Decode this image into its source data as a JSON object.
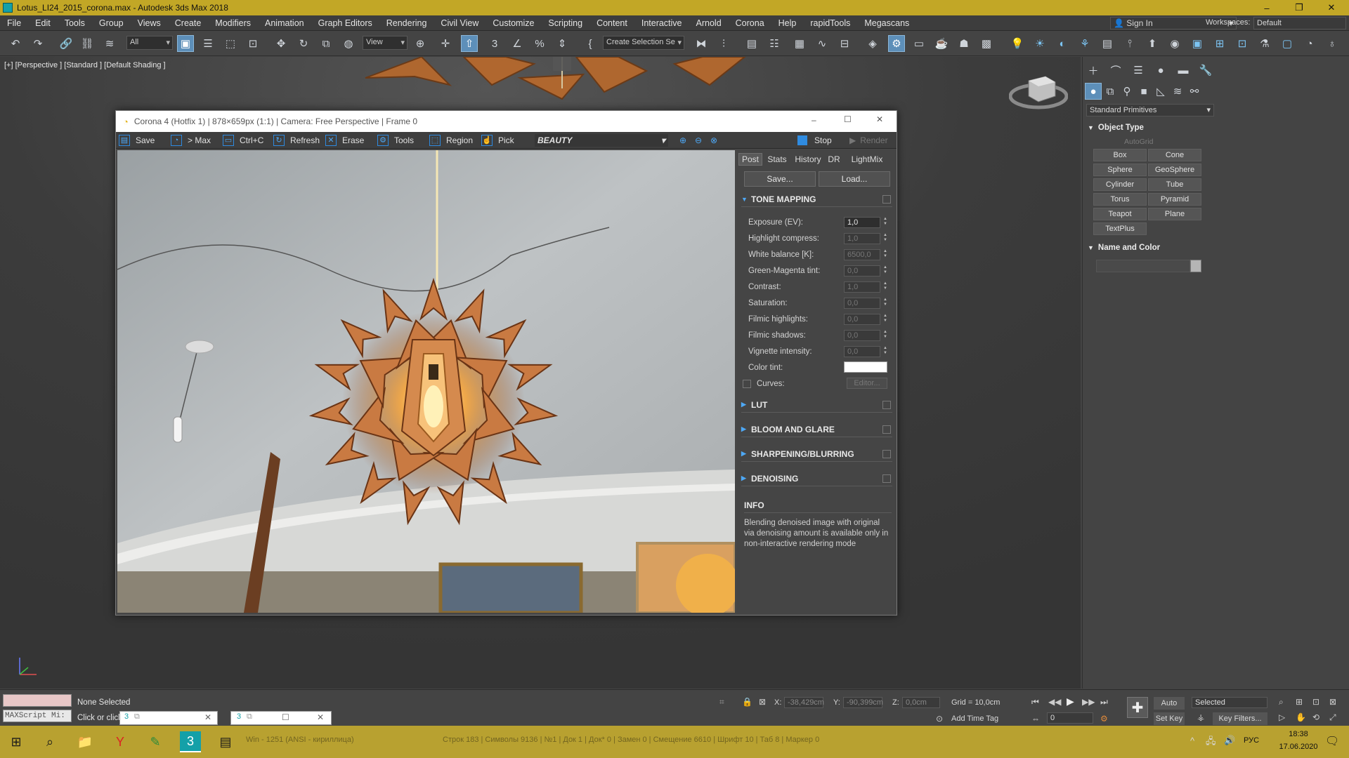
{
  "window": {
    "title": "Lotus_LI24_2015_corona.max - Autodesk 3ds Max 2018",
    "controls": {
      "minimize": "–",
      "restore": "❐",
      "close": "✕"
    }
  },
  "menu": [
    "File",
    "Edit",
    "Tools",
    "Group",
    "Views",
    "Create",
    "Modifiers",
    "Animation",
    "Graph Editors",
    "Rendering",
    "Civil View",
    "Customize",
    "Scripting",
    "Content",
    "Interactive",
    "Arnold",
    "Corona",
    "Help",
    "rapidTools",
    "Megascans"
  ],
  "account": {
    "sign_in": "Sign In",
    "workspaces_label": "Workspaces:",
    "workspace": "Default"
  },
  "toolbar": {
    "filter": "All",
    "view": "View",
    "selection_set": "Create Selection Se"
  },
  "viewport": {
    "label": "[+] [Perspective ] [Standard ] [Default Shading ]"
  },
  "command_panel": {
    "category": "Standard Primitives",
    "object_type_title": "Object Type",
    "autogrid": "AutoGrid",
    "buttons": [
      "Box",
      "Cone",
      "Sphere",
      "GeoSphere",
      "Cylinder",
      "Tube",
      "Torus",
      "Pyramid",
      "Teapot",
      "Plane",
      "TextPlus"
    ],
    "name_color_title": "Name and Color",
    "name_value": ""
  },
  "corona": {
    "title": "Corona 4 (Hotfix 1) | 878×659px (1:1) | Camera: Free Perspective | Frame 0",
    "toolbar": {
      "save": "Save",
      "max": "> Max",
      "copy": "Ctrl+C",
      "refresh": "Refresh",
      "erase": "Erase",
      "tools": "Tools",
      "region": "Region",
      "pick": "Pick",
      "channel": "BEAUTY",
      "stop": "Stop",
      "render": "Render"
    },
    "tabs": [
      "Post",
      "Stats",
      "History",
      "DR",
      "LightMix"
    ],
    "save_btn": "Save...",
    "load_btn": "Load...",
    "tone_mapping": "TONE MAPPING",
    "params": [
      {
        "label": "Exposure (EV):",
        "value": "1,0"
      },
      {
        "label": "Highlight compress:",
        "value": "1,0"
      },
      {
        "label": "White balance [K]:",
        "value": "6500,0"
      },
      {
        "label": "Green-Magenta tint:",
        "value": "0,0"
      },
      {
        "label": "Contrast:",
        "value": "1,0"
      },
      {
        "label": "Saturation:",
        "value": "0,0"
      },
      {
        "label": "Filmic highlights:",
        "value": "0,0"
      },
      {
        "label": "Filmic shadows:",
        "value": "0,0"
      },
      {
        "label": "Vignette intensity:",
        "value": "0,0"
      }
    ],
    "color_tint": "Color tint:",
    "curves": "Curves:",
    "curves_editor": "Editor...",
    "sections": [
      "LUT",
      "BLOOM AND GLARE",
      "SHARPENING/BLURRING",
      "DENOISING"
    ],
    "info_title": "INFO",
    "info_text": "Blending denoised image with original via denoising amount is available only in non-interactive rendering mode"
  },
  "status": {
    "maxscript": "MAXScript Mi:",
    "selection": "None Selected",
    "prompt": "Click or click",
    "x_label": "X:",
    "x": "-38,429cm",
    "y_label": "Y:",
    "y": "-90,399cm",
    "z_label": "Z:",
    "z": "0,0cm",
    "grid": "Grid = 10,0cm",
    "add_time_tag": "Add Time Tag",
    "auto_key": "Auto Key",
    "set_key": "Set Key",
    "key_mode": "Selected",
    "key_filters": "Key Filters...",
    "frame": "0"
  },
  "taskbar": {
    "notepad_status": "Строк 183 | Символы 9136 | №1 | Док 1 | Док* 0 | Замен 0 | Смещение 6610 | Шрифт 10 | Таб 8 | Маркер 0",
    "encoding": "Win - 1251 (ANSI - кириллица)",
    "lang": "РУС",
    "time": "18:38",
    "date": "17.06.2020"
  }
}
